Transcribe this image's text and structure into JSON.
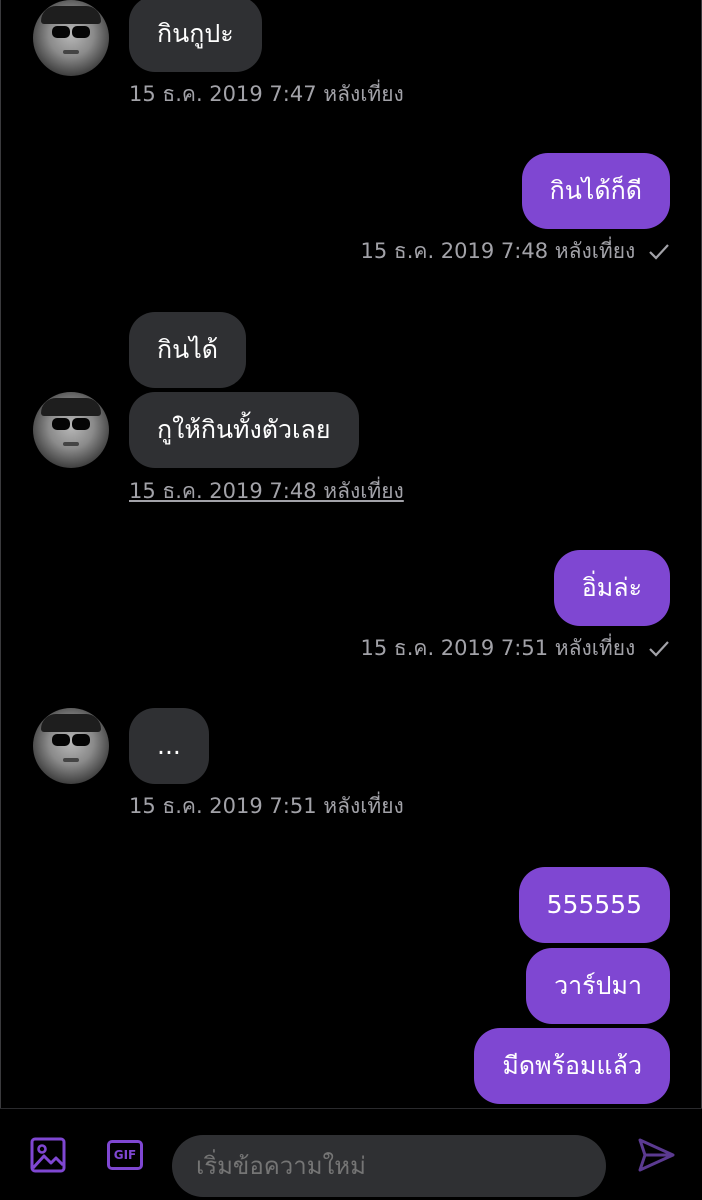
{
  "messages": [
    {
      "side": "in",
      "text": "กินกูปะ"
    },
    {
      "side": "out",
      "text": "กินได้ก็ดี"
    },
    {
      "side": "in",
      "text": "กินได้"
    },
    {
      "side": "in",
      "text": "กูให้กินทั้งตัวเลย"
    },
    {
      "side": "out",
      "text": "อิ่มล่ะ"
    },
    {
      "side": "in",
      "text": "..."
    },
    {
      "side": "out",
      "text": "555555"
    },
    {
      "side": "out",
      "text": "วาร์ปมา"
    },
    {
      "side": "out",
      "text": "มีดพร้อมแล้ว"
    }
  ],
  "timestamps": [
    "15 ธ.ค. 2019 7:47 หลังเที่ยง",
    "15 ธ.ค. 2019 7:48 หลังเที่ยง",
    "15 ธ.ค. 2019 7:48 หลังเที่ยง",
    "15 ธ.ค. 2019 7:51 หลังเที่ยง",
    "15 ธ.ค. 2019 7:51 หลังเที่ยง"
  ],
  "composer": {
    "placeholder": "เริ่มข้อความใหม่",
    "gif_label": "GIF",
    "media_icon": "image-icon",
    "gif_icon": "gif-icon",
    "send_icon": "send-icon"
  },
  "colors": {
    "accent": "#7f47d2",
    "incoming_bubble": "#2f3033",
    "background": "#000000",
    "timestamp": "#a2a2a8"
  }
}
